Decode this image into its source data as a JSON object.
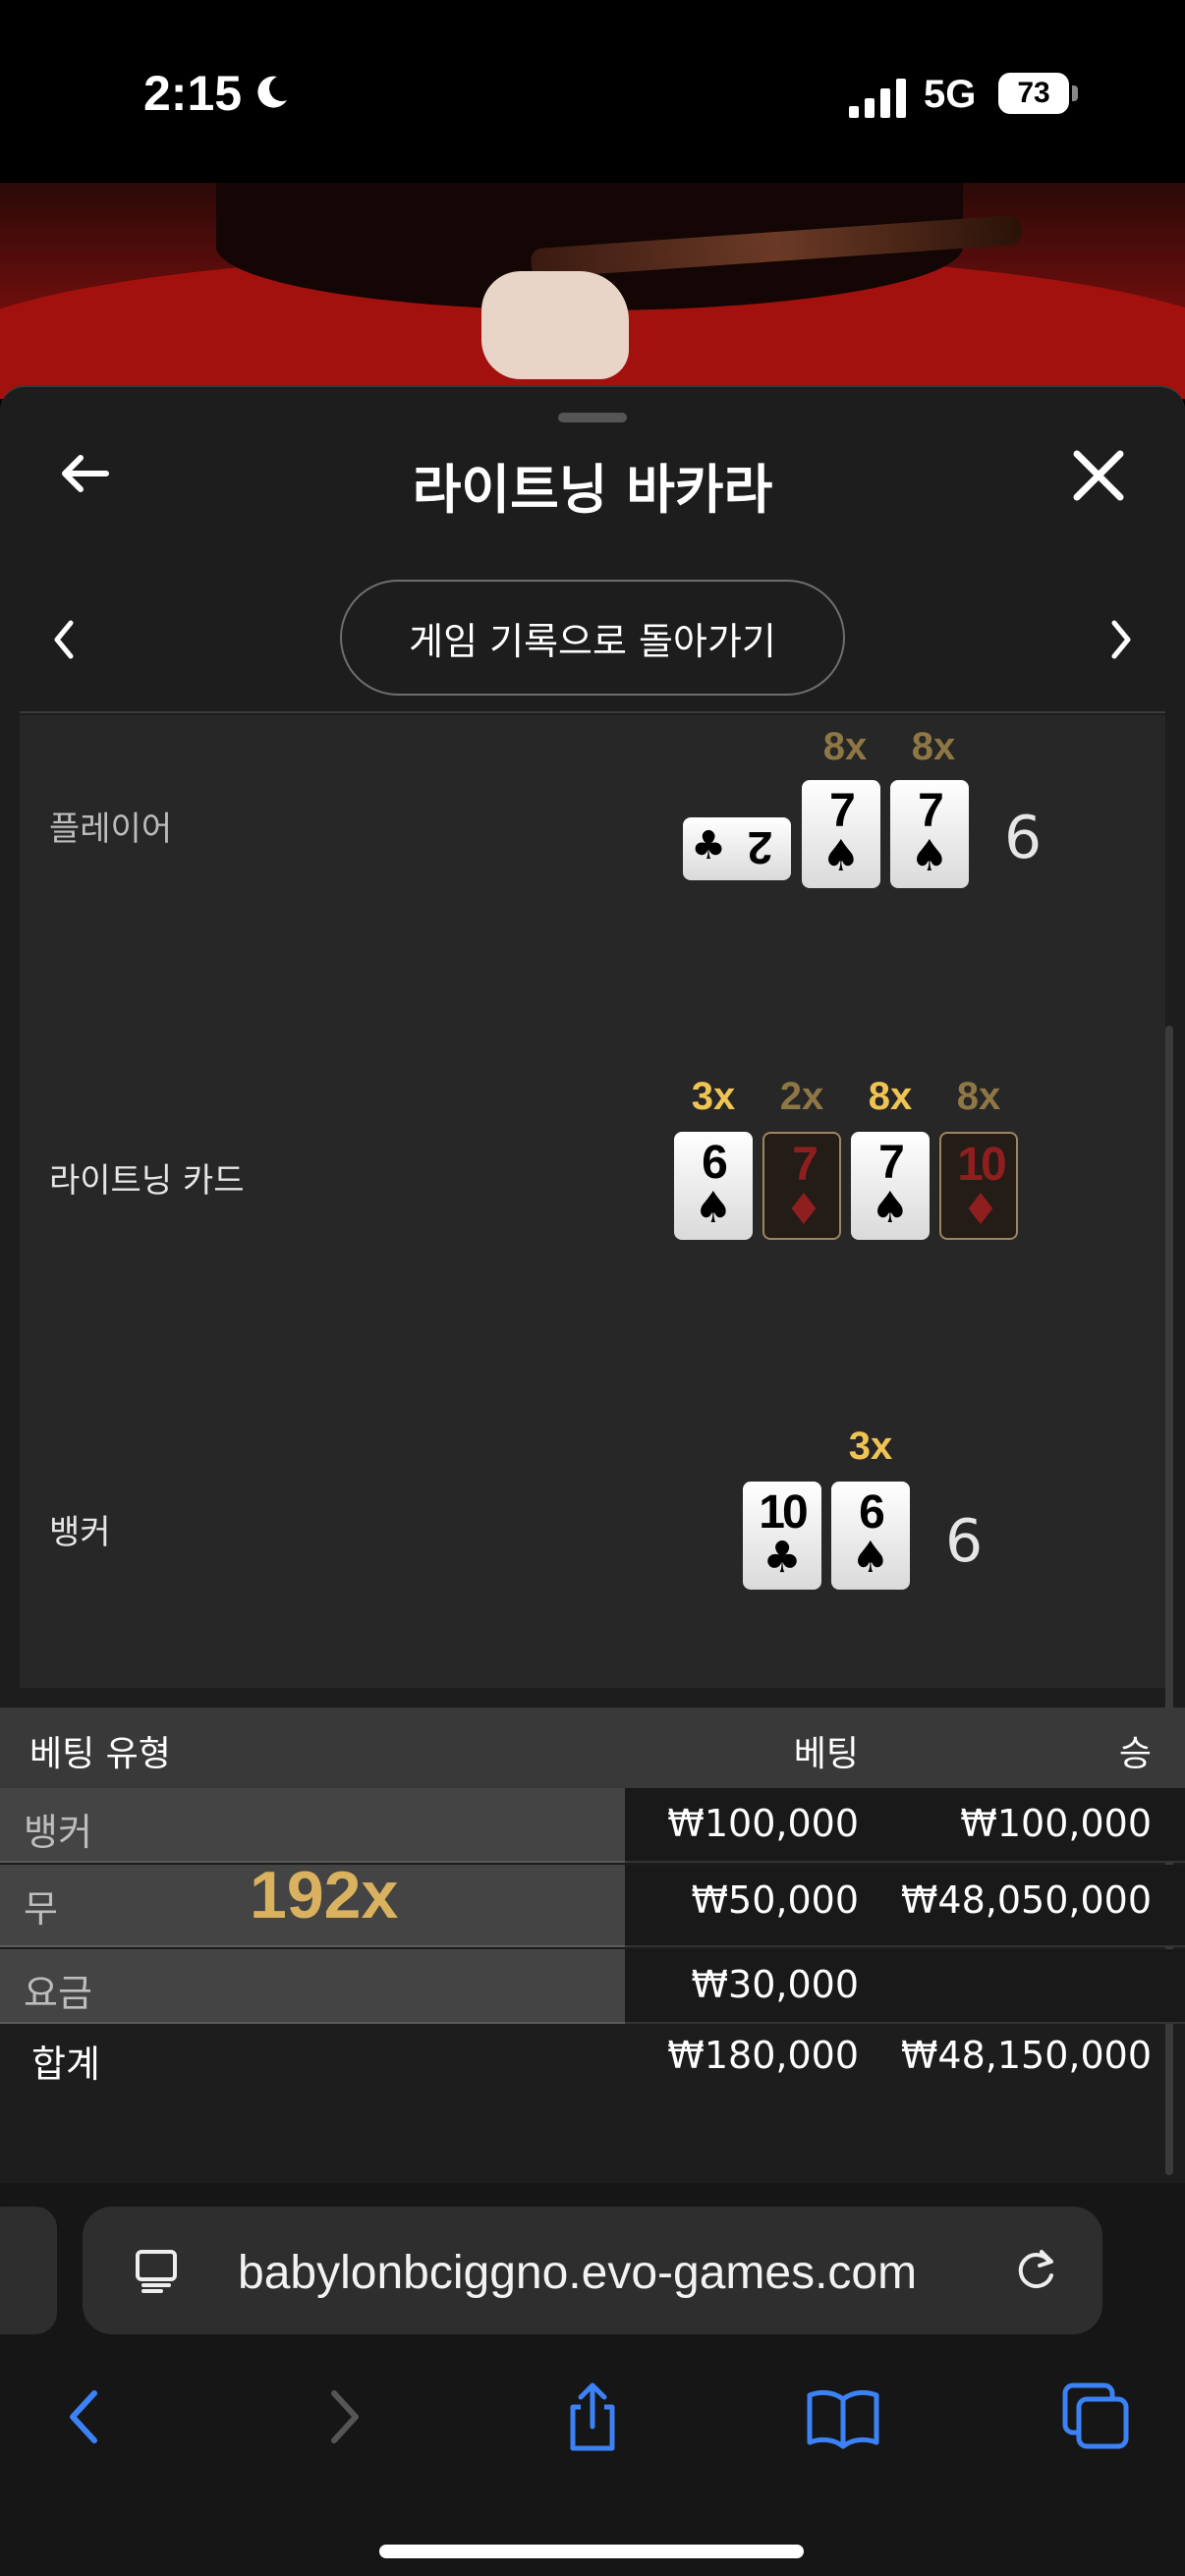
{
  "status_bar": {
    "time": "2:15",
    "network": "5G",
    "battery": "73"
  },
  "header": {
    "title": "라이트닝 바카라"
  },
  "nav": {
    "history_button": "게임 기록으로 돌아가기"
  },
  "round": {
    "player": {
      "label": "플레이어",
      "total": "6",
      "cards": [
        {
          "rank": "2",
          "suit": "♣",
          "multiplier": ""
        },
        {
          "rank": "7",
          "suit": "♠",
          "multiplier": "8x"
        },
        {
          "rank": "7",
          "suit": "♠",
          "multiplier": "8x"
        }
      ]
    },
    "lightning": {
      "label": "라이트닝 카드",
      "cards": [
        {
          "rank": "6",
          "suit": "♠",
          "multiplier": "3x"
        },
        {
          "rank": "7",
          "suit": "♦",
          "multiplier": "2x"
        },
        {
          "rank": "7",
          "suit": "♠",
          "multiplier": "8x"
        },
        {
          "rank": "10",
          "suit": "♦",
          "multiplier": "8x"
        }
      ]
    },
    "banker": {
      "label": "뱅커",
      "total": "6",
      "cards": [
        {
          "rank": "10",
          "suit": "♣",
          "multiplier": ""
        },
        {
          "rank": "6",
          "suit": "♠",
          "multiplier": "3x"
        }
      ]
    }
  },
  "bets": {
    "headers": {
      "type": "베팅 유형",
      "bet": "베팅",
      "win": "승"
    },
    "rows": [
      {
        "name": "뱅커",
        "bet": "₩100,000",
        "win": "₩100,000"
      },
      {
        "name": "무",
        "bet": "₩50,000",
        "win": "₩48,050,000",
        "multiplier": "192x"
      },
      {
        "name": "요금",
        "bet": "₩30,000",
        "win": ""
      }
    ],
    "total": {
      "label": "합계",
      "bet": "₩180,000",
      "win": "₩48,150,000"
    }
  },
  "browser": {
    "url": "babylonbciggno.evo-games.com"
  },
  "colors": {
    "sheet_bg": "#1d1d1d",
    "panel_bg": "#272727",
    "gold": "#f0c453",
    "link_blue": "#3b82f6"
  }
}
